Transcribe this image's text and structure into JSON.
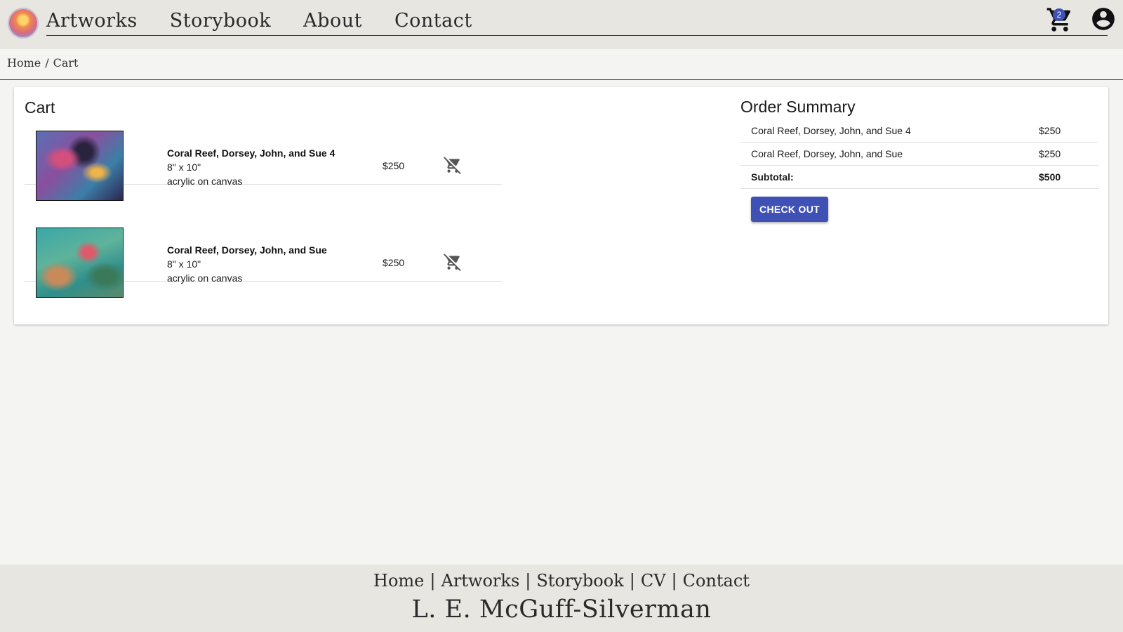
{
  "header": {
    "nav": [
      "Artworks",
      "Storybook",
      "About",
      "Contact"
    ],
    "cart_count": "2"
  },
  "breadcrumb": {
    "home": "Home",
    "separator": "/",
    "current": "Cart"
  },
  "cart": {
    "title": "Cart",
    "items": [
      {
        "title": "Coral Reef, Dorsey, John, and Sue 4",
        "size": "8\" x 10\"",
        "medium": "acrylic on canvas",
        "price": "$250"
      },
      {
        "title": "Coral Reef, Dorsey, John, and Sue",
        "size": "8\" x 10\"",
        "medium": "acrylic on canvas",
        "price": "$250"
      }
    ]
  },
  "summary": {
    "title": "Order Summary",
    "rows": [
      {
        "label": "Coral Reef, Dorsey, John, and Sue 4",
        "value": "$250"
      },
      {
        "label": "Coral Reef, Dorsey, John, and Sue",
        "value": "$250"
      }
    ],
    "subtotal_label": "Subtotal:",
    "subtotal_value": "$500",
    "checkout_label": "CHECK OUT"
  },
  "footer": {
    "links": [
      "Home",
      "Artworks",
      "Storybook",
      "CV",
      "Contact"
    ],
    "separator": "|",
    "name": "L. E. McGuff-Silverman"
  },
  "colors": {
    "accent": "#3f51b5",
    "header_bg": "#e8e6e1",
    "page_bg": "#f4f4f3"
  }
}
